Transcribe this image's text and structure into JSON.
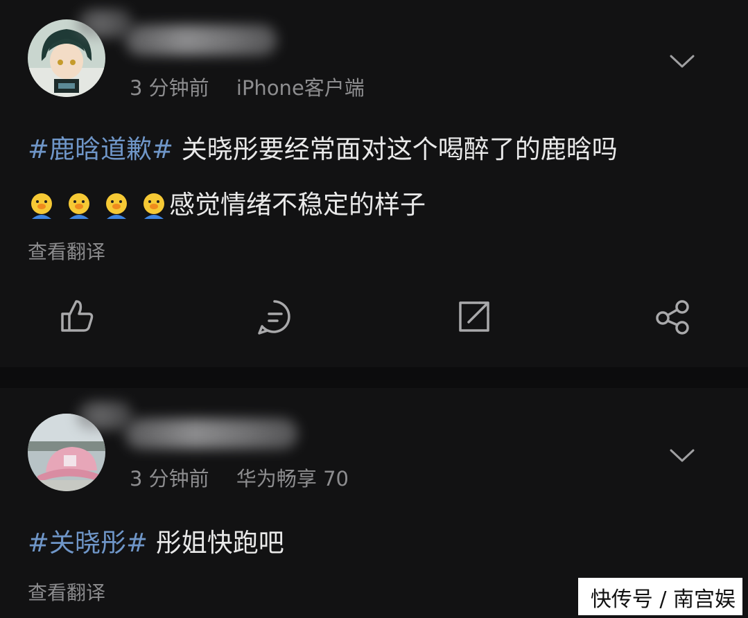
{
  "posts": [
    {
      "time": "3 分钟前",
      "source": "iPhone客户端",
      "hashtag": "#鹿晗道歉#",
      "text_line1": " 关晓彤要经常面对这个喝醉了的鹿晗吗",
      "emoji_count": 4,
      "text_line2": "感觉情绪不稳定的样子",
      "translate": "查看翻译",
      "actions": [
        "like-icon",
        "comment-icon",
        "repost-icon",
        "share-icon"
      ]
    },
    {
      "time": "3 分钟前",
      "source": "华为畅享 70",
      "hashtag": "#关晓彤#",
      "text_line1": " 彤姐快跑吧",
      "translate": "查看翻译"
    }
  ],
  "watermark": "快传号 / 南宫娱",
  "colors": {
    "background": "#0c0c0d",
    "card": "#121213",
    "hashtag": "#6f96c8",
    "meta": "#8d8d8f"
  }
}
